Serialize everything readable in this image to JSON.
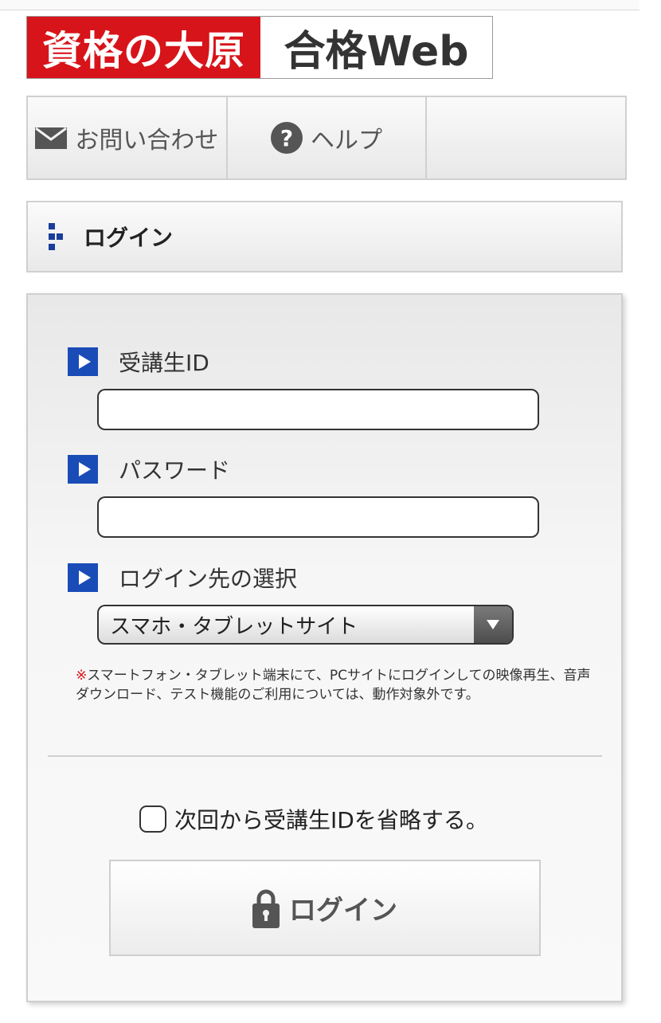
{
  "header": {
    "logo_left": "資格の大原",
    "logo_right": "合格Web"
  },
  "nav": {
    "contact_label": "お問い合わせ",
    "help_label": "ヘルプ",
    "contact_icon": "mail-icon",
    "help_icon": "question-circle-icon"
  },
  "section": {
    "title": "ログイン"
  },
  "form": {
    "student_id_label": "受講生ID",
    "student_id_value": "",
    "password_label": "パスワード",
    "password_value": "",
    "destination_label": "ログイン先の選択",
    "destination_selected": "スマホ・タブレットサイト",
    "note_mark": "※",
    "note_text": "スマートフォン・タブレット端末にて、PCサイトにログインしての映像再生、音声ダウンロード、テスト機能のご利用については、動作対象外です。",
    "remember_label": "次回から受講生IDを省略する。",
    "remember_checked": false,
    "login_button_label": "ログイン"
  },
  "colors": {
    "brand_red": "#d7141a",
    "accent_blue": "#1a4cb8"
  }
}
